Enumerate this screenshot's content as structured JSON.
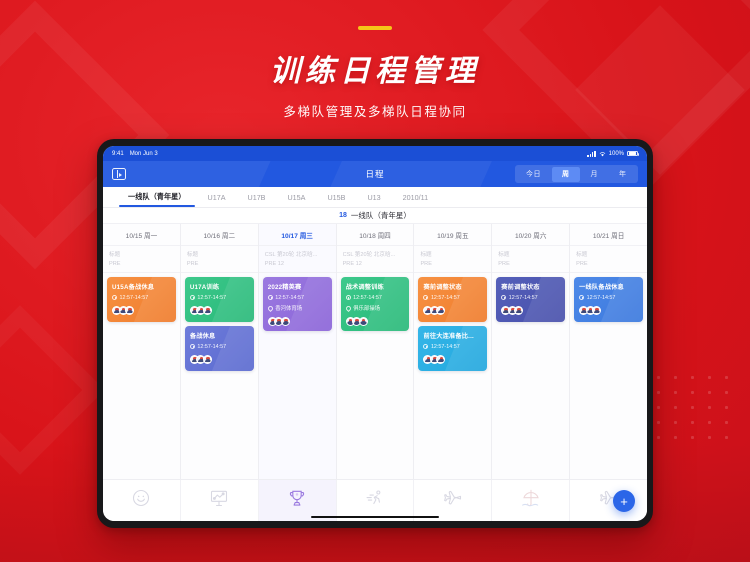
{
  "poster": {
    "title": "训练日程管理",
    "subtitle": "多梯队管理及多梯队日程协同",
    "background_color": "#e11b22",
    "accent_color": "#f5c518"
  },
  "status_bar": {
    "time": "9:41",
    "date": "Mon Jun 3",
    "battery_percent": "100%"
  },
  "nav": {
    "title": "日程",
    "sidebar_toggle_icon": "sidebar-toggle-icon",
    "segments": [
      {
        "label": "今日",
        "active": false
      },
      {
        "label": "周",
        "active": true
      },
      {
        "label": "月",
        "active": false
      },
      {
        "label": "年",
        "active": false
      }
    ]
  },
  "team_tabs": [
    {
      "label": "一线队（青年星）",
      "active": true
    },
    {
      "label": "U17A",
      "active": false
    },
    {
      "label": "U17B",
      "active": false
    },
    {
      "label": "U15A",
      "active": false
    },
    {
      "label": "U15B",
      "active": false
    },
    {
      "label": "U13",
      "active": false
    },
    {
      "label": "2010/11",
      "active": false
    }
  ],
  "team_line": {
    "count": "18",
    "name": "一线队（青年星）"
  },
  "days": [
    {
      "date": "10/15 周一",
      "today": false,
      "meta_line1": "标题",
      "meta_line2": "PRE",
      "events": [
        {
          "title": "U15A备战休息",
          "time": "12:57-14:57",
          "place": "",
          "color": "c-orange",
          "avatars": 3
        }
      ]
    },
    {
      "date": "10/16 周二",
      "today": false,
      "meta_line1": "标题",
      "meta_line2": "PRE",
      "events": [
        {
          "title": "U17A训练",
          "time": "12:57-14:57",
          "place": "",
          "color": "c-green",
          "avatars": 3
        },
        {
          "title": "备战休息",
          "time": "12:57-14:57",
          "place": "",
          "color": "c-indigo",
          "avatars": 3
        }
      ]
    },
    {
      "date": "10/17 周三",
      "today": true,
      "meta_line1": "CSL 第20轮 北京晗...",
      "meta_line2": "PRE 12",
      "events": [
        {
          "title": "2022精英赛",
          "time": "12:57-14:57",
          "place": "香河体育场",
          "color": "c-purple",
          "avatars": 3
        }
      ]
    },
    {
      "date": "10/18 周四",
      "today": false,
      "meta_line1": "CSL 第20轮 北京晗...",
      "meta_line2": "PRE 12",
      "events": [
        {
          "title": "战术调整训练",
          "time": "12:57-14:57",
          "place": "俱乐部操场",
          "color": "c-green",
          "avatars": 3
        }
      ]
    },
    {
      "date": "10/19 周五",
      "today": false,
      "meta_line1": "标题",
      "meta_line2": "PRE",
      "events": [
        {
          "title": "赛前调整状态",
          "time": "12:57-14:57",
          "place": "",
          "color": "c-orange",
          "avatars": 3
        },
        {
          "title": "前往大连准备比...",
          "time": "12:57-14:57",
          "place": "",
          "color": "c-cyan",
          "avatars": 3
        }
      ]
    },
    {
      "date": "10/20 周六",
      "today": false,
      "meta_line1": "标题",
      "meta_line2": "PRE",
      "events": [
        {
          "title": "赛前调整状态",
          "time": "12:57-14:57",
          "place": "",
          "color": "c-darkindigo",
          "avatars": 3
        }
      ]
    },
    {
      "date": "10/21 周日",
      "today": false,
      "meta_line1": "标题",
      "meta_line2": "PRE",
      "events": [
        {
          "title": "一线队备战休息",
          "time": "12:57-14:57",
          "place": "",
          "color": "c-blue",
          "avatars": 3
        }
      ]
    }
  ],
  "icon_strip": [
    {
      "icon": "rest-smiley-icon",
      "selected": false
    },
    {
      "icon": "tactics-board-icon",
      "selected": false
    },
    {
      "icon": "trophy-icon",
      "selected": true
    },
    {
      "icon": "running-icon",
      "selected": false
    },
    {
      "icon": "airplane-icon",
      "selected": false
    },
    {
      "icon": "beach-umbrella-icon",
      "selected": false
    },
    {
      "icon": "airplane-icon",
      "selected": false
    }
  ],
  "fab": {
    "label": "+"
  }
}
